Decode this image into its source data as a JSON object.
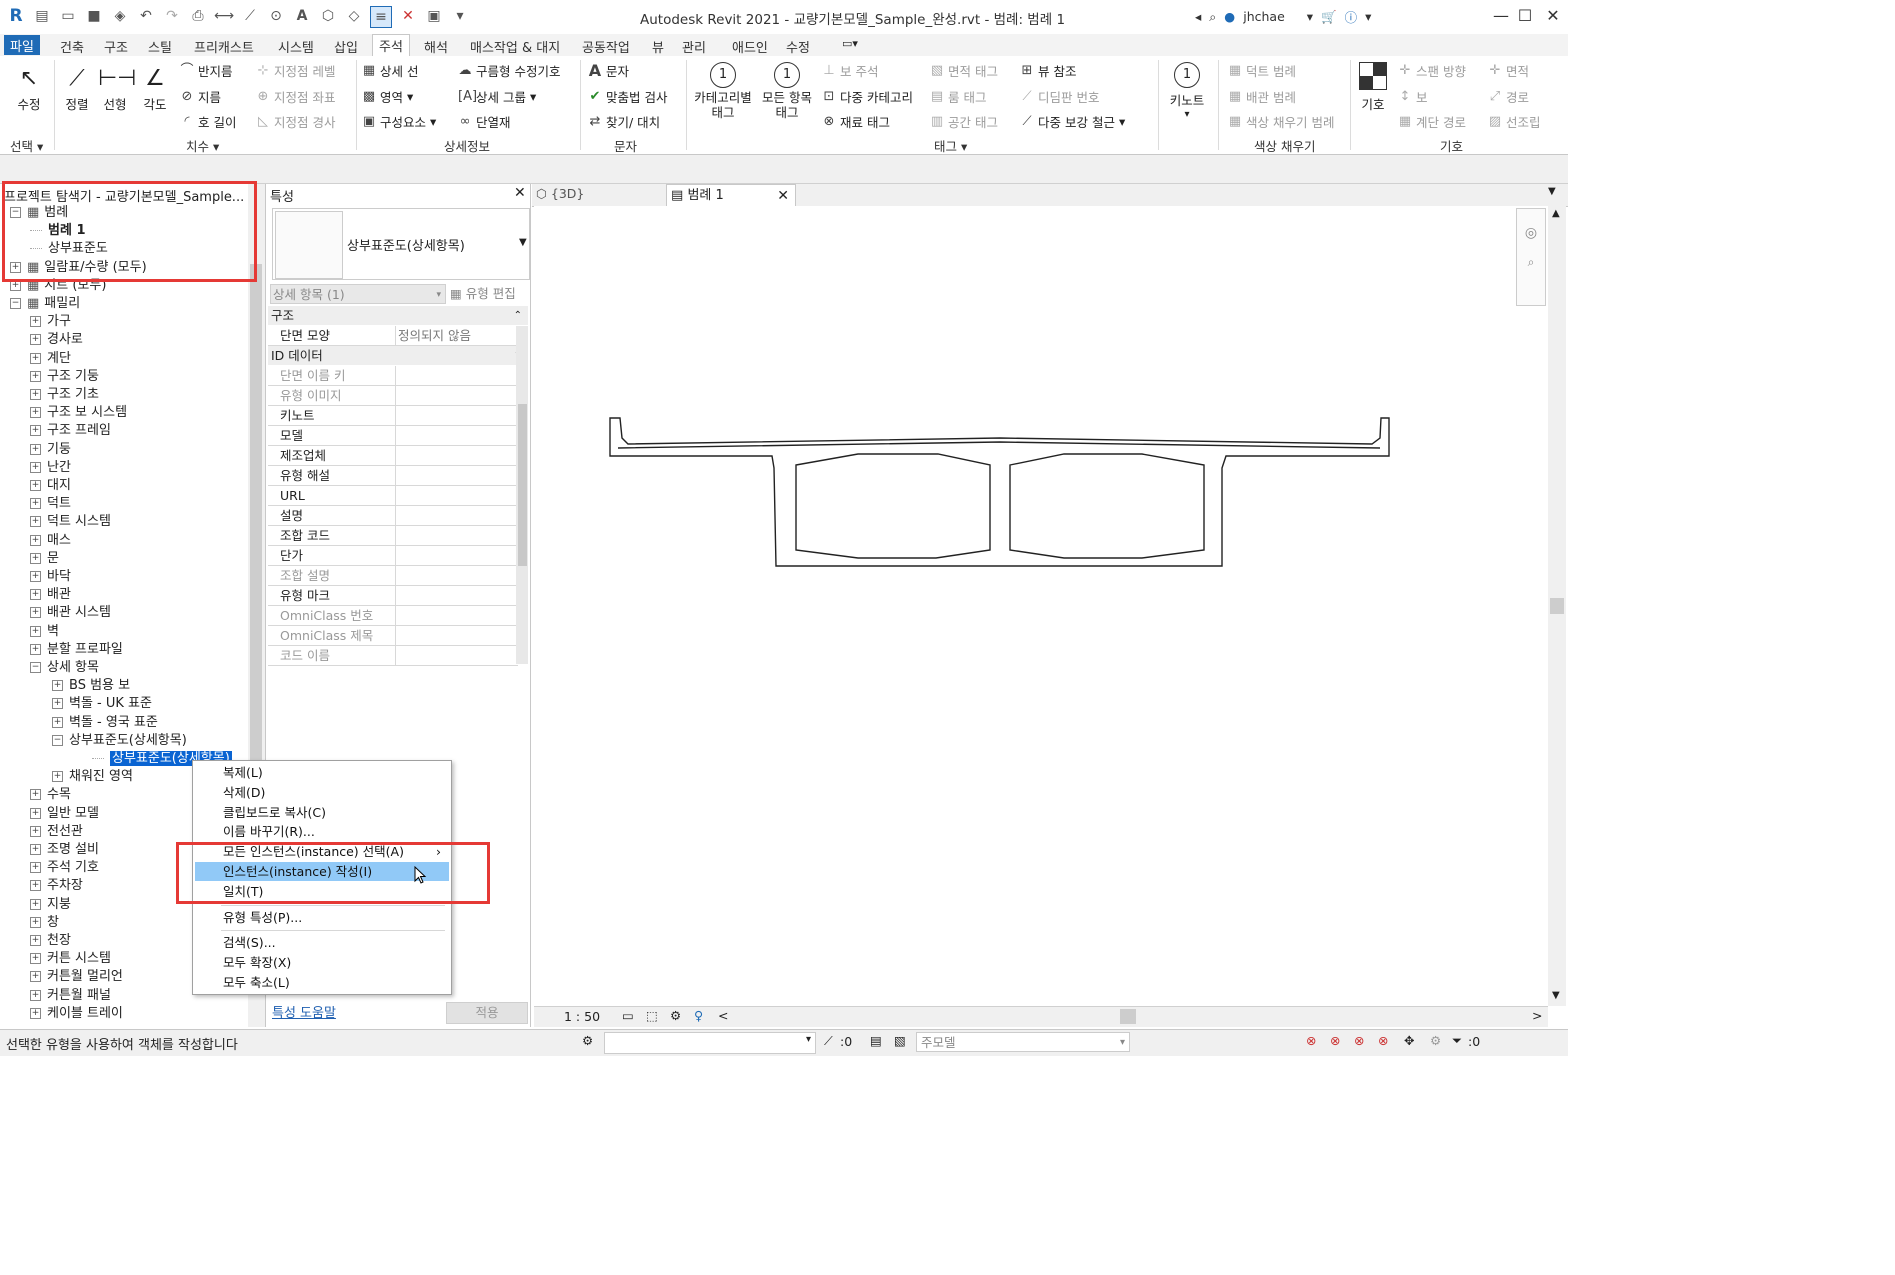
{
  "titlebar": {
    "title": "Autodesk Revit 2021 - 교량기본모델_Sample_완성.rvt - 범례: 범례 1",
    "user": "jhchae"
  },
  "ribbon_tabs": [
    "파일",
    "건축",
    "구조",
    "스틸",
    "프리캐스트",
    "시스템",
    "삽입",
    "주석",
    "해석",
    "매스작업 & 대지",
    "공동작업",
    "뷰",
    "관리",
    "애드인",
    "수정"
  ],
  "ribbon": {
    "select": {
      "modify": "수정",
      "panel": "선택"
    },
    "dimension": {
      "aligned": "정렬",
      "linear": "선형",
      "angular": "각도",
      "radial": "반지름",
      "diameter": "지름",
      "arc_length": "호 길이",
      "spot_elevation": "지정점 레벨",
      "spot_coordinate": "지정점 좌표",
      "spot_slope": "지정점 경사",
      "panel": "치수"
    },
    "detail": {
      "detail_line": "상세 선",
      "region": "영역",
      "component": "구성요소",
      "revision_cloud": "구름형 수정기호",
      "detail_group": "상세 그룹",
      "insulation": "단열재",
      "panel": "상세정보"
    },
    "text": {
      "text": "문자",
      "spelling": "맞춤법 검사",
      "find_replace": "찾기/ 대치",
      "panel": "문자"
    },
    "tag": {
      "by_category": "카테고리별\n태그",
      "all": "모든 항목\n태그",
      "beam_annotation": "보 주석",
      "multi_category": "다중 카테고리",
      "material": "재료 태그",
      "area": "면적 태그",
      "room": "룸 태그",
      "space": "공간 태그",
      "view_reference": "뷰 참조",
      "tread_number": "디딤판 번호",
      "multi_rebar": "다중 보강 철근",
      "keynote": "키노트",
      "panel": "태그"
    },
    "color_fill": {
      "duct_legend": "덕트 범례",
      "pipe_legend": "배관 범례",
      "color_fill_legend": "색상 채우기 범례",
      "panel": "색상 채우기"
    },
    "symbol": {
      "symbol": "기호",
      "span_direction": "스팬 방향",
      "beam": "보",
      "stair_path": "계단 경로",
      "area": "면적",
      "path": "경로",
      "rebar": "선조립",
      "panel": "기호"
    }
  },
  "browser": {
    "title": "프로젝트 탐색기 - 교량기본모델_Sample...",
    "nodes": [
      {
        "label": "범례",
        "indent": 0,
        "pm": "−",
        "icon": true
      },
      {
        "label": "범례 1",
        "indent": 1,
        "pm": "",
        "bold": true
      },
      {
        "label": "상부표준도",
        "indent": 1,
        "pm": ""
      },
      {
        "label": "일람표/수량 (모두)",
        "indent": 0,
        "pm": "+",
        "icon": true
      },
      {
        "label": "시트 (모두)",
        "indent": 0,
        "pm": "+",
        "icon": true
      },
      {
        "label": "패밀리",
        "indent": 0,
        "pm": "−",
        "icon": true
      },
      {
        "label": "가구",
        "indent": 1,
        "pm": "+"
      },
      {
        "label": "경사로",
        "indent": 1,
        "pm": "+"
      },
      {
        "label": "계단",
        "indent": 1,
        "pm": "+"
      },
      {
        "label": "구조 기둥",
        "indent": 1,
        "pm": "+"
      },
      {
        "label": "구조 기초",
        "indent": 1,
        "pm": "+"
      },
      {
        "label": "구조 보 시스템",
        "indent": 1,
        "pm": "+"
      },
      {
        "label": "구조 프레임",
        "indent": 1,
        "pm": "+"
      },
      {
        "label": "기둥",
        "indent": 1,
        "pm": "+"
      },
      {
        "label": "난간",
        "indent": 1,
        "pm": "+"
      },
      {
        "label": "대지",
        "indent": 1,
        "pm": "+"
      },
      {
        "label": "덕트",
        "indent": 1,
        "pm": "+"
      },
      {
        "label": "덕트 시스템",
        "indent": 1,
        "pm": "+"
      },
      {
        "label": "매스",
        "indent": 1,
        "pm": "+"
      },
      {
        "label": "문",
        "indent": 1,
        "pm": "+"
      },
      {
        "label": "바닥",
        "indent": 1,
        "pm": "+"
      },
      {
        "label": "배관",
        "indent": 1,
        "pm": "+"
      },
      {
        "label": "배관 시스템",
        "indent": 1,
        "pm": "+"
      },
      {
        "label": "벽",
        "indent": 1,
        "pm": "+"
      },
      {
        "label": "분할 프로파일",
        "indent": 1,
        "pm": "+"
      },
      {
        "label": "상세 항목",
        "indent": 1,
        "pm": "−"
      },
      {
        "label": "BS 범용 보",
        "indent": 2,
        "pm": "+"
      },
      {
        "label": "벽돌 - UK 표준",
        "indent": 2,
        "pm": "+"
      },
      {
        "label": "벽돌 - 영국 표준",
        "indent": 2,
        "pm": "+"
      },
      {
        "label": "상부표준도(상세항목)",
        "indent": 2,
        "pm": "−"
      },
      {
        "label": "상부표준도(상세항목)",
        "indent": 3,
        "pm": "",
        "selected": true
      },
      {
        "label": "채워진 영역",
        "indent": 2,
        "pm": "+"
      },
      {
        "label": "수목",
        "indent": 1,
        "pm": "+"
      },
      {
        "label": "일반 모델",
        "indent": 1,
        "pm": "+"
      },
      {
        "label": "전선관",
        "indent": 1,
        "pm": "+"
      },
      {
        "label": "조명 설비",
        "indent": 1,
        "pm": "+"
      },
      {
        "label": "주석 기호",
        "indent": 1,
        "pm": "+"
      },
      {
        "label": "주차장",
        "indent": 1,
        "pm": "+"
      },
      {
        "label": "지붕",
        "indent": 1,
        "pm": "+"
      },
      {
        "label": "창",
        "indent": 1,
        "pm": "+"
      },
      {
        "label": "천장",
        "indent": 1,
        "pm": "+"
      },
      {
        "label": "커튼 시스템",
        "indent": 1,
        "pm": "+"
      },
      {
        "label": "커튼월 멀리언",
        "indent": 1,
        "pm": "+"
      },
      {
        "label": "커튼월 패널",
        "indent": 1,
        "pm": "+"
      },
      {
        "label": "케이블 트레이",
        "indent": 1,
        "pm": "+"
      }
    ]
  },
  "properties": {
    "title": "특성",
    "type_name": "상부표준도(상세항목)",
    "selector": "상세 항목 (1)",
    "edit_type": "유형 편집",
    "sections": [
      {
        "name": "구조",
        "rows": [
          {
            "k": "단면 모양",
            "v": "정의되지 않음"
          }
        ]
      },
      {
        "name": "ID 데이터",
        "rows": [
          {
            "k": "단면 이름 키",
            "v": "",
            "dim": true
          },
          {
            "k": "유형 이미지",
            "v": "",
            "dim": true
          },
          {
            "k": "키노트",
            "v": ""
          },
          {
            "k": "모델",
            "v": ""
          },
          {
            "k": "제조업체",
            "v": ""
          },
          {
            "k": "유형 해설",
            "v": ""
          },
          {
            "k": "URL",
            "v": ""
          },
          {
            "k": "설명",
            "v": ""
          },
          {
            "k": "조합 코드",
            "v": ""
          },
          {
            "k": "단가",
            "v": ""
          },
          {
            "k": "조합 설명",
            "v": "",
            "dim": true
          },
          {
            "k": "유형 마크",
            "v": ""
          },
          {
            "k": "OmniClass 번호",
            "v": "",
            "dim": true
          },
          {
            "k": "OmniClass 제목",
            "v": "",
            "dim": true
          },
          {
            "k": "코드 이름",
            "v": "",
            "dim": true
          }
        ]
      }
    ],
    "help": "특성 도움말",
    "apply": "적용"
  },
  "view_tabs": [
    {
      "label": "{3D}"
    },
    {
      "label": "범례 1",
      "active": true
    }
  ],
  "viewbar": {
    "scale": "1 : 50"
  },
  "context_menu": {
    "items": [
      {
        "label": "복제(L)"
      },
      {
        "label": "삭제(D)"
      },
      {
        "label": "클립보드로 복사(C)"
      },
      {
        "label": "이름 바꾸기(R)..."
      },
      {
        "label": "모든 인스턴스(instance) 선택(A)",
        "submenu": true
      },
      {
        "label": "인스턴스(instance) 작성(I)",
        "highlighted": true
      },
      {
        "label": "일치(T)"
      },
      {
        "label": "유형 특성(P)...",
        "sep_before": true
      },
      {
        "label": "검색(S)...",
        "sep_before": true
      },
      {
        "label": "모두 확장(X)"
      },
      {
        "label": "모두 축소(L)"
      }
    ]
  },
  "statusbar": {
    "message": "선택한 유형을 사용하여 객체를 작성합니다",
    "count": ":0",
    "model": "주모델",
    "filter_count": ":0"
  },
  "colors": {
    "accent": "#1f6bb6",
    "highlight": "#91c9f7",
    "selection": "#0a64d2",
    "annotation_red": "#e53935"
  }
}
